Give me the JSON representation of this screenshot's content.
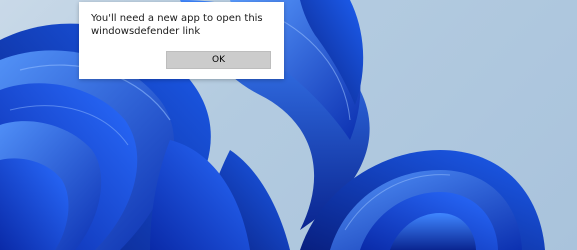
{
  "dialog": {
    "message": "You'll need a new app to open this windowsdefender link",
    "ok_label": "OK"
  },
  "colors": {
    "wallpaper_background": "#b3cbe0",
    "bloom_dark": "#0a2aa8",
    "bloom_mid": "#1a54e6",
    "bloom_light": "#4a8cff",
    "dialog_background": "#ffffff",
    "button_background": "#cccccc"
  }
}
